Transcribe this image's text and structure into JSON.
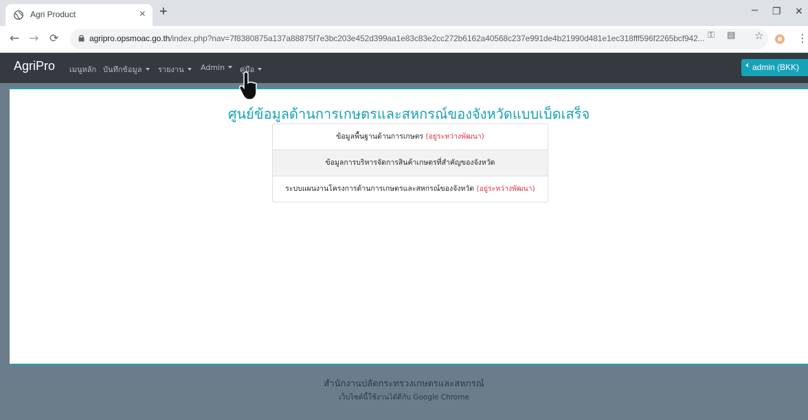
{
  "browser": {
    "tab_title": "Agri Product",
    "tab_close": "×",
    "new_tab": "+",
    "window_controls": {
      "minimize": "–",
      "restore": "❐",
      "close": "✕"
    },
    "url_domain": "agripro.opsmoac.go.th",
    "url_path": "/index.php?nav=7f8380875a137a88875f7e3bc203e452d399aa1e83c83e2cc272b6162a40568c237e991de4b21990d481e1ec318fff596f2265bcf942...",
    "icons": [
      "globe-icon",
      "back-icon",
      "forward-icon",
      "reload-icon",
      "lock-icon",
      "key-icon",
      "translate-icon",
      "star-icon",
      "extension-icon",
      "menu-icon"
    ]
  },
  "app": {
    "brand": "AgriPro",
    "nav": [
      {
        "label": "เมนูหลัก",
        "dropdown": false
      },
      {
        "label": "บันทึกข้อมูล",
        "dropdown": true
      },
      {
        "label": "รายงาน",
        "dropdown": true
      },
      {
        "label": "Admin",
        "dropdown": true
      },
      {
        "label": "คู่มือ",
        "dropdown": true
      }
    ],
    "user_button": "admin (BKK)",
    "accent_color": "#17a2b8"
  },
  "main": {
    "title": "ศูนย์ข้อมูลด้านการเกษตรและสหกรณ์ของจังหวัดแบบเบ็ดเสร็จ",
    "items": [
      {
        "text": "ข้อมูลพื้นฐานด้านการเกษตร",
        "note": "(อยู่ระหว่างพัฒนา)"
      },
      {
        "text": "ข้อมูลการบริหารจัดการสินค้าเกษตรที่สำคัญของจังหวัด",
        "note": ""
      },
      {
        "text": "ระบบแผนงานโครงการด้านการเกษตรและสหกรณ์ของจังหวัด",
        "note": "(อยู่ระหว่างพัฒนา)"
      }
    ]
  },
  "footer": {
    "org": "สำนักงานปลัดกระทรวงเกษตรและสหกรณ์",
    "note": "เว็บไซต์นี้ใช้งานได้ดีกับ Google Chrome"
  }
}
